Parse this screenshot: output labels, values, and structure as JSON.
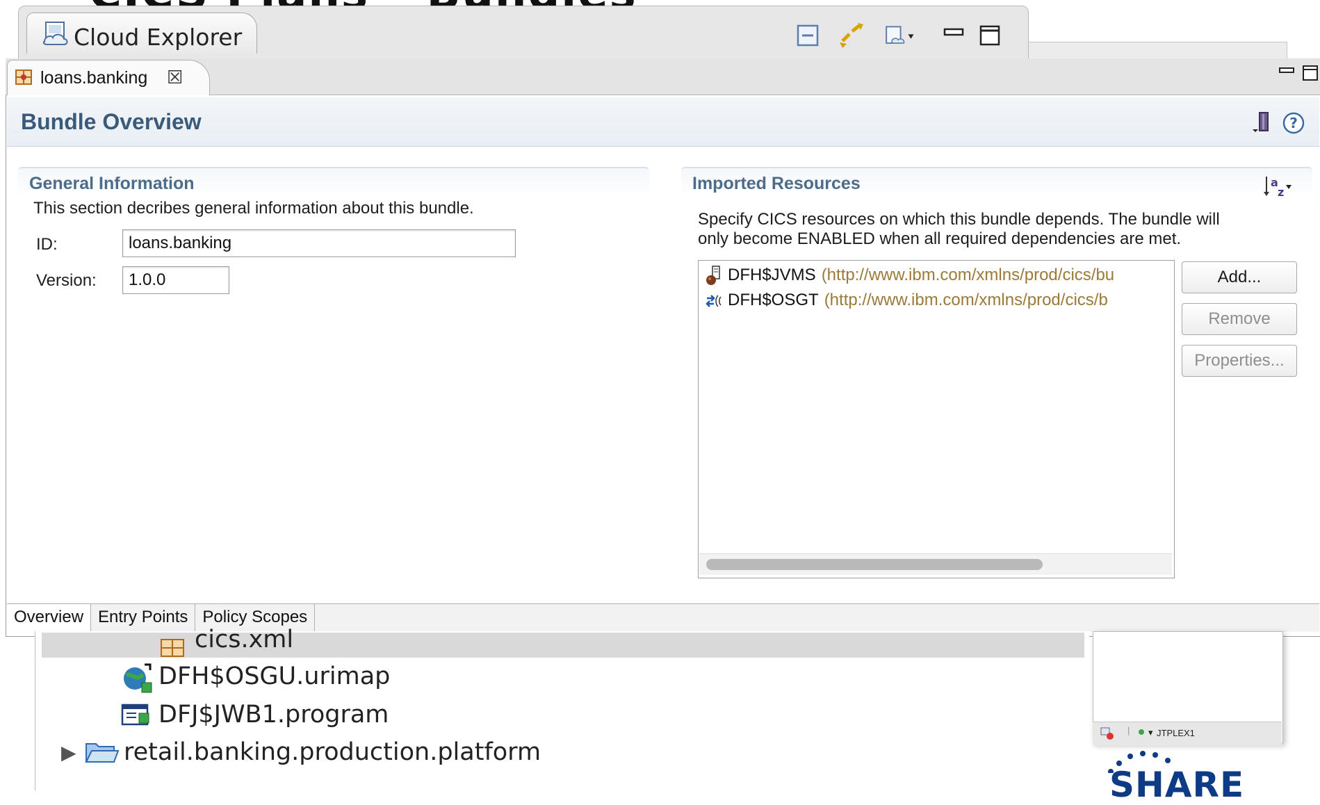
{
  "slide": {
    "title_partial": "CICS Plans – Bundles"
  },
  "cloud_explorer": {
    "tab_label": "Cloud Explorer",
    "icon": "cloud-explorer-icon",
    "tools": [
      "collapse-all-icon",
      "link-sync-icon",
      "view-menu-icon",
      "minimize-icon",
      "maximize-icon"
    ]
  },
  "editor": {
    "tab_label": "loans.banking",
    "tab_close": "☒",
    "header_title": "Bundle Overview",
    "general": {
      "title": "General Information",
      "description": "This section decribes general information about this bundle.",
      "id_label": "ID:",
      "id_value": "loans.banking",
      "version_label": "Version:",
      "version_value": "1.0.0"
    },
    "imported": {
      "title": "Imported Resources",
      "description_line1": "Specify CICS resources on which this bundle depends. The bundle will",
      "description_line2": "only become ENABLED when all required dependencies are met.",
      "items": [
        {
          "name": "DFH$JVMS",
          "url": "(http://www.ibm.com/xmlns/prod/cics/bu",
          "icon": "jvm-server-icon"
        },
        {
          "name": "DFH$OSGT",
          "url": "(http://www.ibm.com/xmlns/prod/cics/b",
          "icon": "osgi-service-icon"
        }
      ],
      "buttons": {
        "add": "Add...",
        "remove": "Remove",
        "properties": "Properties..."
      }
    },
    "bottom_tabs": [
      "Overview",
      "Entry Points",
      "Policy Scopes"
    ],
    "active_tab": "Overview"
  },
  "project_explorer": {
    "items": [
      {
        "label": "cics.xml",
        "icon": "bundle-manifest-icon",
        "selected": true
      },
      {
        "label": "DFH$OSGU.urimap",
        "icon": "urimap-icon"
      },
      {
        "label": "DFJ$JWB1.program",
        "icon": "program-icon"
      },
      {
        "label": "retail.banking.production.platform",
        "icon": "folder-icon"
      }
    ]
  },
  "status": {
    "plex": "JTPLEX1"
  },
  "footer_logo": "SHARE",
  "colors": {
    "section_title": "#4d6c8a",
    "header_title": "#3a5a7a",
    "url_text": "#9b7a3a"
  }
}
